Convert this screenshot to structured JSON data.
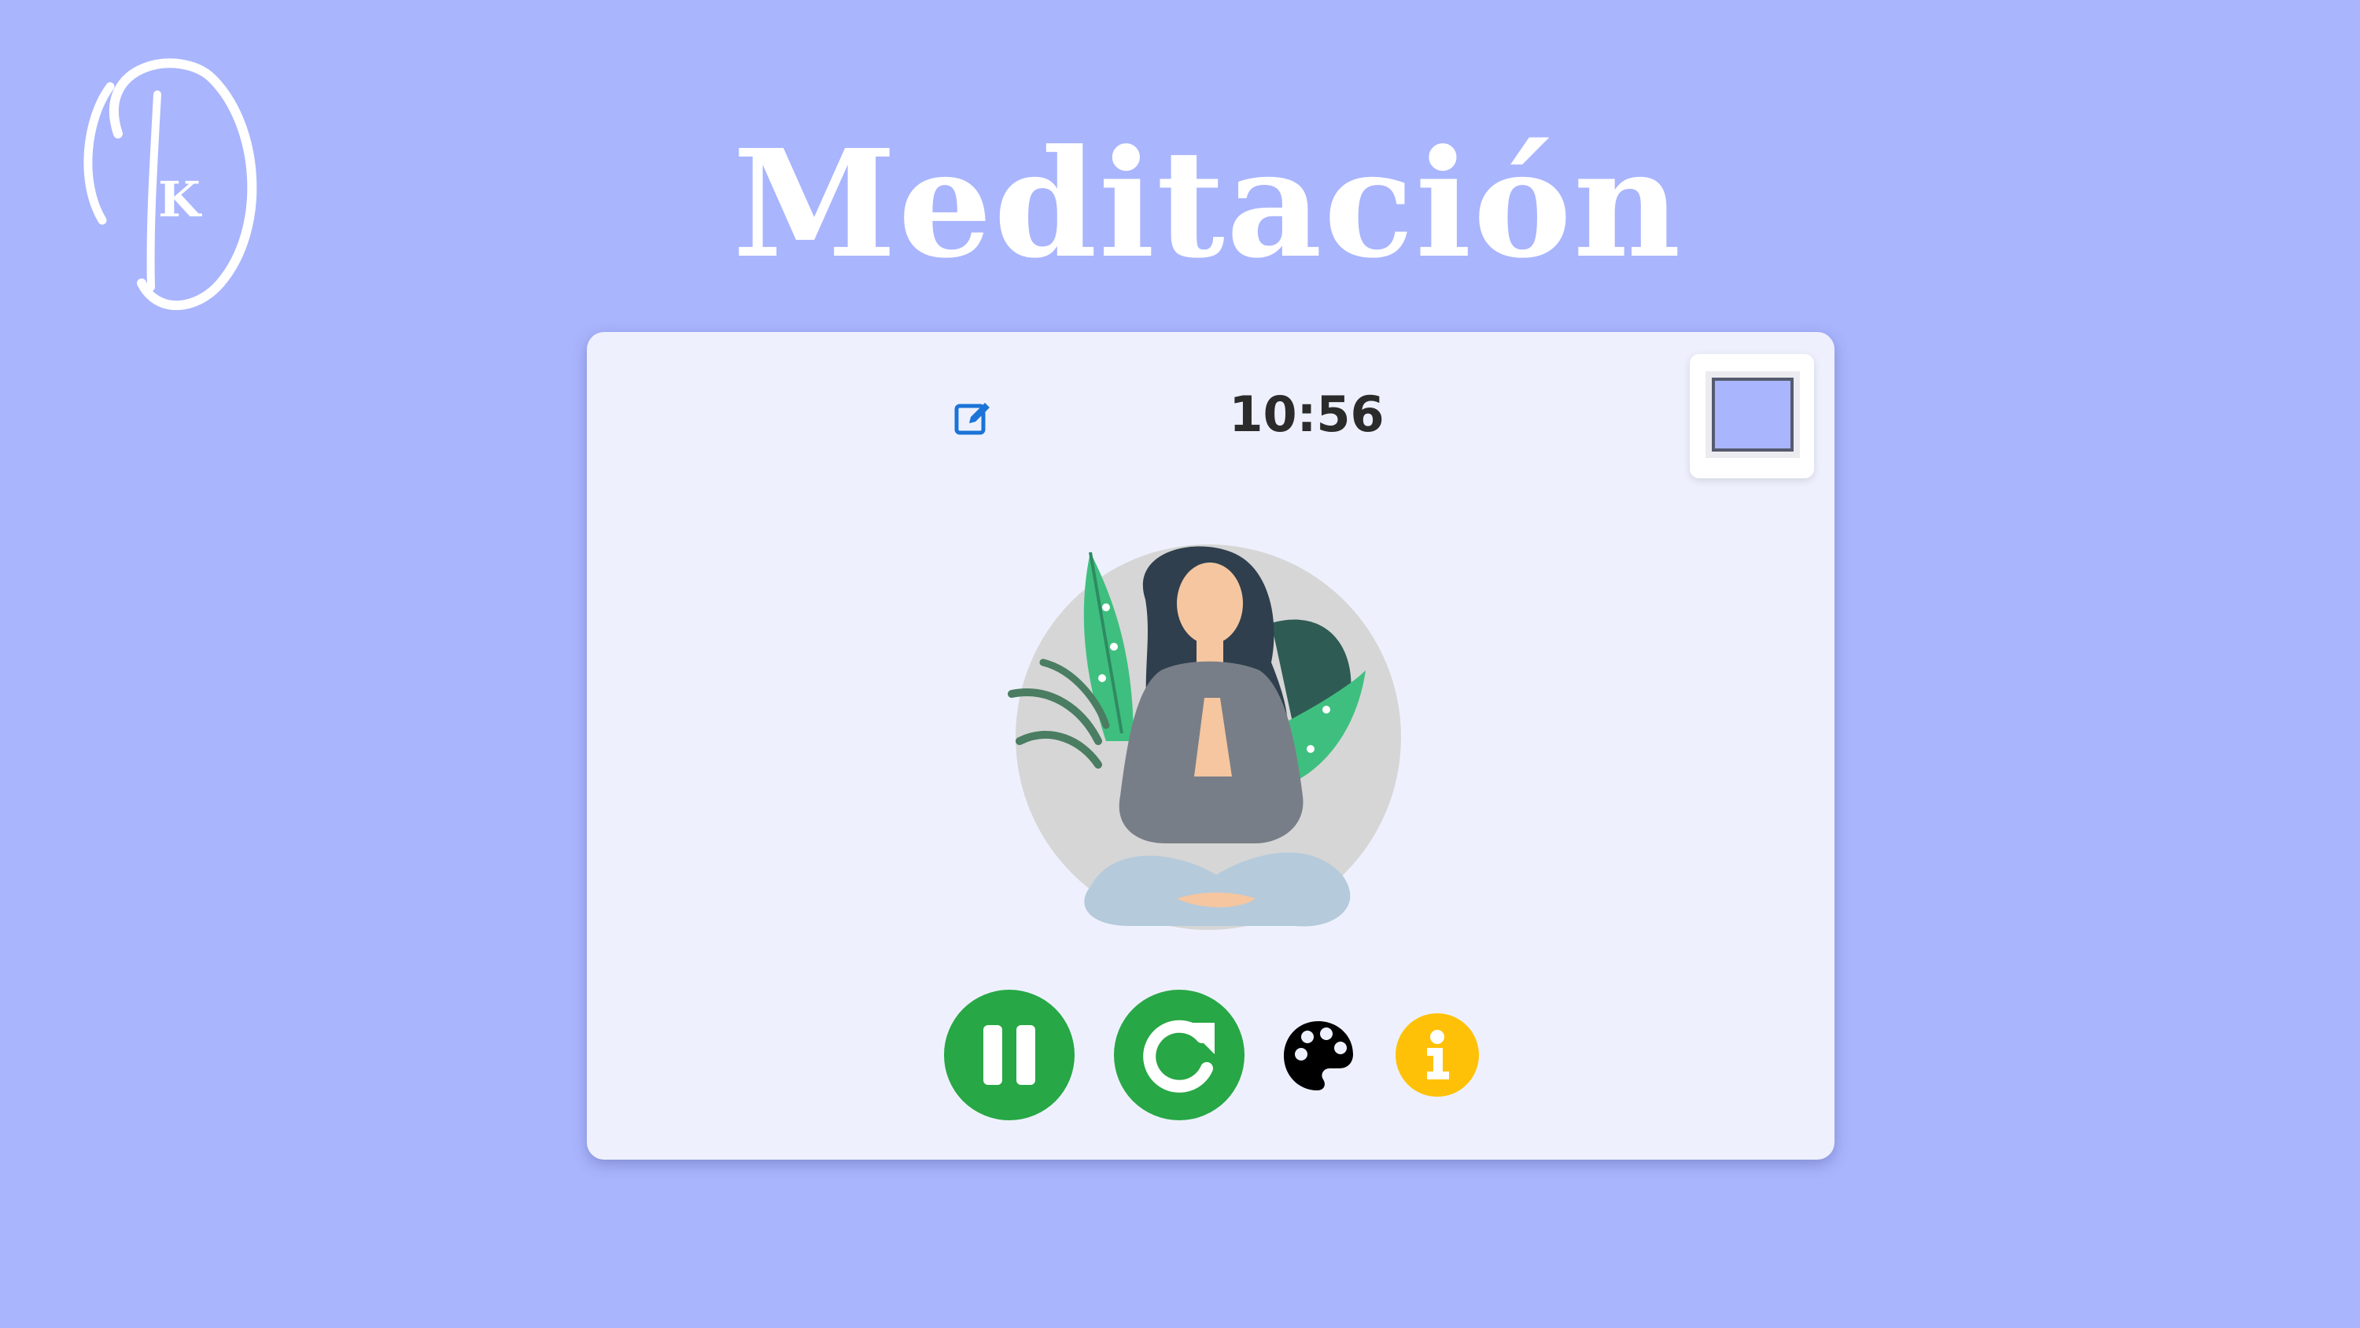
{
  "app": {
    "title": "Meditación",
    "logo_letter": "K",
    "background_color": "#a9b5fd"
  },
  "timer": {
    "display": "10:56"
  },
  "settings": {
    "edit_icon": "edit-icon",
    "selected_color": "#a9b5fd"
  },
  "controls": {
    "pause_icon": "pause-icon",
    "restart_icon": "restart-icon",
    "theme_icon": "palette-icon",
    "info_icon": "info-icon",
    "accent_color": "#27a745",
    "info_color": "#ffc107"
  }
}
